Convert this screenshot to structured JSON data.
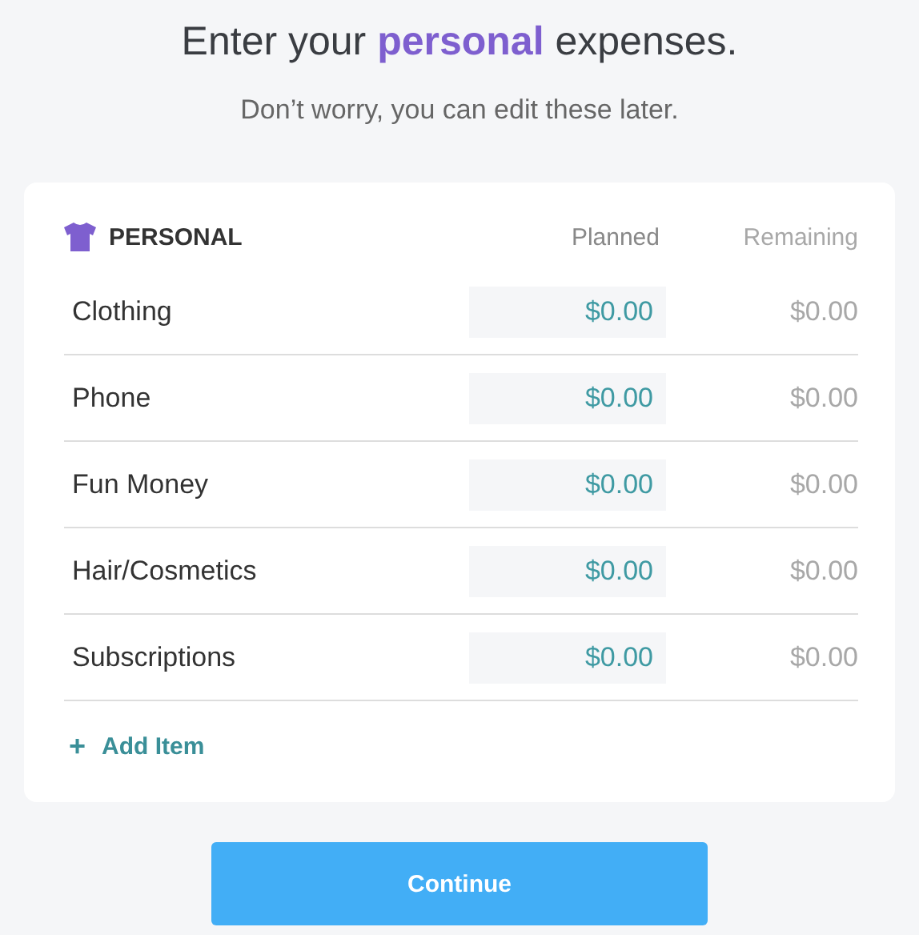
{
  "heading": "Enter your **personal** expenses.",
  "subheading": "Don’t worry, you can edit these later.",
  "card": {
    "title": "PERSONAL",
    "columns": [
      "Planned",
      "Remaining"
    ],
    "rows": [
      {
        "name": "Clothing",
        "planned": "$0.00",
        "remaining": "$0.00"
      },
      {
        "name": "Phone",
        "planned": "$0.00",
        "remaining": "$0.00"
      },
      {
        "name": "Fun Money",
        "planned": "$0.00",
        "remaining": "$0.00"
      },
      {
        "name": "Hair/Cosmetics",
        "planned": "$0.00",
        "remaining": "$0.00"
      },
      {
        "name": "Subscriptions",
        "planned": "$0.00",
        "remaining": "$0.00"
      }
    ],
    "add_item": {
      "icon": "+",
      "label": "Add Item"
    }
  },
  "button": "Continue"
}
